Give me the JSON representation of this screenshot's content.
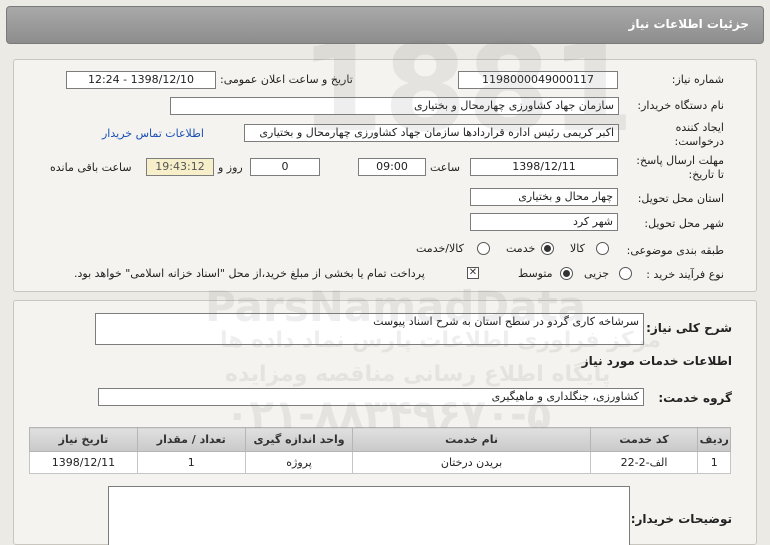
{
  "header": {
    "title": "جزئیات اطلاعات نیاز"
  },
  "form": {
    "need_number_label": "شماره نیاز:",
    "need_number": "1198000049000117",
    "announce_label": "تاریخ و ساعت اعلان عمومی:",
    "announce_value": "1398/12/10 - 12:24",
    "buyer_org_label": "نام دستگاه خریدار:",
    "buyer_org": "سازمان جهاد کشاورزی چهارمحال و بختیاری",
    "creator_label": "ایجاد کننده درخواست:",
    "creator": "اکبر کریمی رئیس اداره قراردادها سازمان جهاد کشاورزی چهارمحال و بختیاری",
    "contact_link": "اطلاعات تماس خریدار",
    "deadline_label": "مهلت ارسال پاسخ: تا تاریخ:",
    "deadline_date": "1398/12/11",
    "time_label": "ساعت",
    "deadline_time": "09:00",
    "days_value": "0",
    "days_label": "روز و",
    "remaining_time": "19:43:12",
    "remaining_label": "ساعت باقی مانده",
    "province_label": "استان محل تحویل:",
    "province": "چهار محال و بختیاری",
    "city_label": "شهر محل تحویل:",
    "city": "شهر کرد",
    "category_label": "طبقه بندی موضوعی:",
    "category_options": [
      "کالا",
      "خدمت",
      "کالا/خدمت"
    ],
    "category_selected": "خدمت",
    "process_label": "نوع فرآیند خرید :",
    "process_options": [
      "جزیی",
      "متوسط"
    ],
    "process_selected": "متوسط",
    "payment_note": "پرداخت تمام یا بخشی از مبلغ خرید،از محل \"اسناد خزانه اسلامی\" خواهد بود."
  },
  "summary": {
    "desc_label": "شرح کلی نیاز:",
    "desc_value": "سرشاخه کاری گردو در سطح استان به شرح اسناد پیوست",
    "services_title": "اطلاعات خدمات مورد نیاز",
    "group_label": "گروه خدمت:",
    "group_value": "کشاورزی، جنگلداری و ماهیگیری",
    "buyer_notes_label": "توضیحات خریدار:"
  },
  "table": {
    "headers": [
      "ردیف",
      "کد خدمت",
      "نام خدمت",
      "واحد اندازه گیری",
      "تعداد / مقدار",
      "تاریخ نیاز"
    ],
    "rows": [
      [
        "1",
        "الف-2-22",
        "بریدن درختان",
        "پروژه",
        "1",
        "1398/12/11"
      ]
    ]
  },
  "watermark": {
    "brand": "ParsNamadData",
    "line1": "مرکز فراوری اطلاعات پارس نماد داده ها",
    "line2": "پایگاه اطلاع رسانی مناقصه ومزایده",
    "phone": "۰۲۱-۸۸۳۴۹۶۷۰-۵",
    "big_number": "1881"
  }
}
